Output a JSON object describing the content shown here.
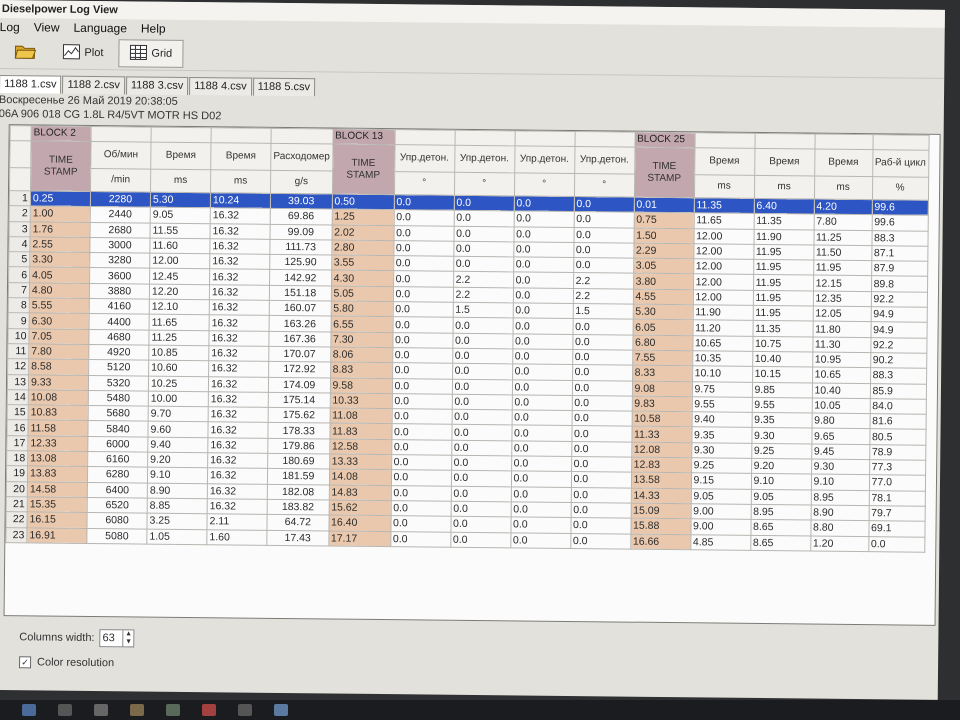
{
  "window_title": "Dieselpower Log View",
  "menu": [
    "Log",
    "View",
    "Language",
    "Help"
  ],
  "toolbar": {
    "plot_label": "Plot",
    "grid_label": "Grid"
  },
  "tabs": [
    "1188 1.csv",
    "1188 2.csv",
    "1188 3.csv",
    "1188 4.csv",
    "1188 5.csv"
  ],
  "info": {
    "date": "Воскресенье 26 Май 2019 20:38:05",
    "ecu": "06A 906 018 CG  1.8L R4/5VT MOTR HS D02"
  },
  "groups": {
    "block2": "BLOCK 2",
    "block13": "BLOCK 13",
    "block25": "BLOCK 25"
  },
  "headers": [
    {
      "name": "TIME STAMP",
      "unit": ""
    },
    {
      "name": "Об/мин",
      "unit": "/min"
    },
    {
      "name": "Время",
      "unit": "ms"
    },
    {
      "name": "Время",
      "unit": "ms"
    },
    {
      "name": "Расходомер",
      "unit": "g/s"
    },
    {
      "name": "TIME STAMP",
      "unit": ""
    },
    {
      "name": "Упр.детон.",
      "unit": "°"
    },
    {
      "name": "Упр.детон.",
      "unit": "°"
    },
    {
      "name": "Упр.детон.",
      "unit": "°"
    },
    {
      "name": "Упр.детон.",
      "unit": "°"
    },
    {
      "name": "TIME STAMP",
      "unit": ""
    },
    {
      "name": "Время",
      "unit": "ms"
    },
    {
      "name": "Время",
      "unit": "ms"
    },
    {
      "name": "Время",
      "unit": "ms"
    },
    {
      "name": "Раб-й цикл",
      "unit": "%"
    }
  ],
  "rows": [
    [
      "0.25",
      "2280",
      "5.30",
      "10.24",
      "39.03",
      "0.50",
      "0.0",
      "0.0",
      "0.0",
      "0.0",
      "0.01",
      "11.35",
      "6.40",
      "4.20",
      "99.6"
    ],
    [
      "1.00",
      "2440",
      "9.05",
      "16.32",
      "69.86",
      "1.25",
      "0.0",
      "0.0",
      "0.0",
      "0.0",
      "0.75",
      "11.65",
      "11.35",
      "7.80",
      "99.6"
    ],
    [
      "1.76",
      "2680",
      "11.55",
      "16.32",
      "99.09",
      "2.02",
      "0.0",
      "0.0",
      "0.0",
      "0.0",
      "1.50",
      "12.00",
      "11.90",
      "11.25",
      "88.3"
    ],
    [
      "2.55",
      "3000",
      "11.60",
      "16.32",
      "111.73",
      "2.80",
      "0.0",
      "0.0",
      "0.0",
      "0.0",
      "2.29",
      "12.00",
      "11.95",
      "11.50",
      "87.1"
    ],
    [
      "3.30",
      "3280",
      "12.00",
      "16.32",
      "125.90",
      "3.55",
      "0.0",
      "0.0",
      "0.0",
      "0.0",
      "3.05",
      "12.00",
      "11.95",
      "11.95",
      "87.9"
    ],
    [
      "4.05",
      "3600",
      "12.45",
      "16.32",
      "142.92",
      "4.30",
      "0.0",
      "2.2",
      "0.0",
      "2.2",
      "3.80",
      "12.00",
      "11.95",
      "12.15",
      "89.8"
    ],
    [
      "4.80",
      "3880",
      "12.20",
      "16.32",
      "151.18",
      "5.05",
      "0.0",
      "2.2",
      "0.0",
      "2.2",
      "4.55",
      "12.00",
      "11.95",
      "12.35",
      "92.2"
    ],
    [
      "5.55",
      "4160",
      "12.10",
      "16.32",
      "160.07",
      "5.80",
      "0.0",
      "1.5",
      "0.0",
      "1.5",
      "5.30",
      "11.90",
      "11.95",
      "12.05",
      "94.9"
    ],
    [
      "6.30",
      "4400",
      "11.65",
      "16.32",
      "163.26",
      "6.55",
      "0.0",
      "0.0",
      "0.0",
      "0.0",
      "6.05",
      "11.20",
      "11.35",
      "11.80",
      "94.9"
    ],
    [
      "7.05",
      "4680",
      "11.25",
      "16.32",
      "167.36",
      "7.30",
      "0.0",
      "0.0",
      "0.0",
      "0.0",
      "6.80",
      "10.65",
      "10.75",
      "11.30",
      "92.2"
    ],
    [
      "7.80",
      "4920",
      "10.85",
      "16.32",
      "170.07",
      "8.06",
      "0.0",
      "0.0",
      "0.0",
      "0.0",
      "7.55",
      "10.35",
      "10.40",
      "10.95",
      "90.2"
    ],
    [
      "8.58",
      "5120",
      "10.60",
      "16.32",
      "172.92",
      "8.83",
      "0.0",
      "0.0",
      "0.0",
      "0.0",
      "8.33",
      "10.10",
      "10.15",
      "10.65",
      "88.3"
    ],
    [
      "9.33",
      "5320",
      "10.25",
      "16.32",
      "174.09",
      "9.58",
      "0.0",
      "0.0",
      "0.0",
      "0.0",
      "9.08",
      "9.75",
      "9.85",
      "10.40",
      "85.9"
    ],
    [
      "10.08",
      "5480",
      "10.00",
      "16.32",
      "175.14",
      "10.33",
      "0.0",
      "0.0",
      "0.0",
      "0.0",
      "9.83",
      "9.55",
      "9.55",
      "10.05",
      "84.0"
    ],
    [
      "10.83",
      "5680",
      "9.70",
      "16.32",
      "175.62",
      "11.08",
      "0.0",
      "0.0",
      "0.0",
      "0.0",
      "10.58",
      "9.40",
      "9.35",
      "9.80",
      "81.6"
    ],
    [
      "11.58",
      "5840",
      "9.60",
      "16.32",
      "178.33",
      "11.83",
      "0.0",
      "0.0",
      "0.0",
      "0.0",
      "11.33",
      "9.35",
      "9.30",
      "9.65",
      "80.5"
    ],
    [
      "12.33",
      "6000",
      "9.40",
      "16.32",
      "179.86",
      "12.58",
      "0.0",
      "0.0",
      "0.0",
      "0.0",
      "12.08",
      "9.30",
      "9.25",
      "9.45",
      "78.9"
    ],
    [
      "13.08",
      "6160",
      "9.20",
      "16.32",
      "180.69",
      "13.33",
      "0.0",
      "0.0",
      "0.0",
      "0.0",
      "12.83",
      "9.25",
      "9.20",
      "9.30",
      "77.3"
    ],
    [
      "13.83",
      "6280",
      "9.10",
      "16.32",
      "181.59",
      "14.08",
      "0.0",
      "0.0",
      "0.0",
      "0.0",
      "13.58",
      "9.15",
      "9.10",
      "9.10",
      "77.0"
    ],
    [
      "14.58",
      "6400",
      "8.90",
      "16.32",
      "182.08",
      "14.83",
      "0.0",
      "0.0",
      "0.0",
      "0.0",
      "14.33",
      "9.05",
      "9.05",
      "8.95",
      "78.1"
    ],
    [
      "15.35",
      "6520",
      "8.85",
      "16.32",
      "183.82",
      "15.62",
      "0.0",
      "0.0",
      "0.0",
      "0.0",
      "15.09",
      "9.00",
      "8.95",
      "8.90",
      "79.7"
    ],
    [
      "16.15",
      "6080",
      "3.25",
      "2.11",
      "64.72",
      "16.40",
      "0.0",
      "0.0",
      "0.0",
      "0.0",
      "15.88",
      "9.00",
      "8.65",
      "8.80",
      "69.1"
    ],
    [
      "16.91",
      "5080",
      "1.05",
      "1.60",
      "17.43",
      "17.17",
      "0.0",
      "0.0",
      "0.0",
      "0.0",
      "16.66",
      "4.85",
      "8.65",
      "1.20",
      "0.0"
    ]
  ],
  "columns_width_label": "Columns width:",
  "columns_width_value": "63",
  "color_resolution_label": "Color resolution"
}
